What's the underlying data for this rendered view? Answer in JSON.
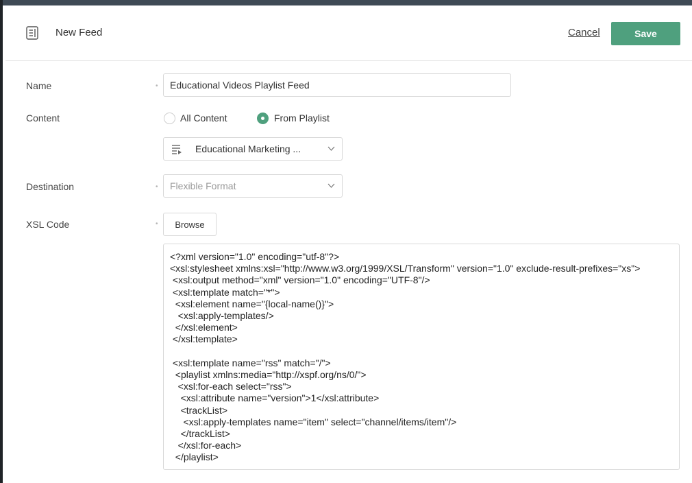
{
  "header": {
    "title": "New Feed",
    "icon": "document-icon",
    "cancel_label": "Cancel",
    "save_label": "Save",
    "save_color": "#4fa07e"
  },
  "form": {
    "name": {
      "label": "Name",
      "value": "Educational Videos Playlist Feed"
    },
    "content": {
      "label": "Content",
      "options": [
        {
          "label": "All Content",
          "selected": false
        },
        {
          "label": "From Playlist",
          "selected": true
        }
      ],
      "playlist_value": "Educational Marketing ..."
    },
    "destination": {
      "label": "Destination",
      "placeholder": "Flexible Format"
    },
    "xsl": {
      "label": "XSL Code",
      "browse_label": "Browse",
      "code": "<?xml version=\"1.0\" encoding=\"utf-8\"?>\n<xsl:stylesheet xmlns:xsl=\"http://www.w3.org/1999/XSL/Transform\" version=\"1.0\" exclude-result-prefixes=\"xs\">\n <xsl:output method=\"xml\" version=\"1.0\" encoding=\"UTF-8\"/>\n <xsl:template match=\"*\">\n  <xsl:element name=\"{local-name()}\">\n   <xsl:apply-templates/>\n  </xsl:element>\n </xsl:template>\n\n <xsl:template name=\"rss\" match=\"/\">\n  <playlist xmlns:media=\"http://xspf.org/ns/0/\">\n   <xsl:for-each select=\"rss\">\n    <xsl:attribute name=\"version\">1</xsl:attribute>\n    <trackList>\n     <xsl:apply-templates name=\"item\" select=\"channel/items/item\"/>\n    </trackList>\n   </xsl:for-each>\n  </playlist>"
    }
  }
}
